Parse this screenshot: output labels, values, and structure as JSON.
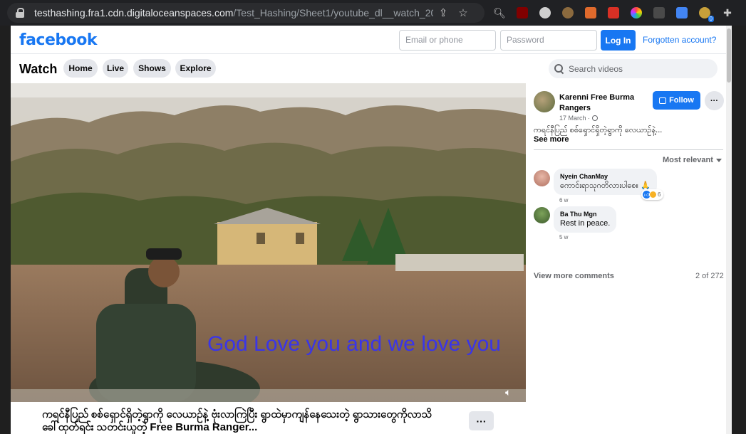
{
  "browser": {
    "url_host": "testhashing.fra1.cdn.digitaloceanspaces.com",
    "url_path": "/Test_Hashing/Sheet1/youtube_dl__watch_20...",
    "extension_badge": "0"
  },
  "header": {
    "logo": "facebook",
    "email_placeholder": "Email or phone",
    "password_placeholder": "Password",
    "login_label": "Log In",
    "forgot_label": "Forgotten account?"
  },
  "watch_nav": {
    "title": "Watch",
    "tabs": [
      {
        "label": "Home"
      },
      {
        "label": "Live"
      },
      {
        "label": "Shows"
      },
      {
        "label": "Explore"
      }
    ],
    "search_placeholder": "Search videos"
  },
  "video": {
    "caption": "God Love you and we love you",
    "post_title": "ကရင်နီပြည် စစ်ရှောင်ရှိတဲ့ရွာကို လေယာဉ်နဲ့ ဗုံးလာကြဲပြီး ရွာထဲမှာကျန်နေသေးတဲ့ ရွာသားတွေကိုလာသိခေါ်ထုတ်ရင်း သတင်းယူတဲ့ Free Burma Ranger..."
  },
  "post": {
    "page_name": "Karenni Free Burma Rangers",
    "date": "17 March ·",
    "follow_label": "Follow",
    "text": "ကရင်နီပြည် စစ်ရှောင်ရှိတဲ့ရွာကို လေယာဉ်နဲ့...",
    "see_more": "See more",
    "sort_label": "Most relevant"
  },
  "comments": [
    {
      "name": "Nyein ChanMay",
      "text": "ကောင်းရာသုဂတိလားပါစေ။ 🙏",
      "time": "6 w",
      "reactions": "6"
    },
    {
      "name": "Ba Thu Mgn",
      "text": "Rest in peace.",
      "time": "5 w"
    }
  ],
  "comments_footer": {
    "view_more": "View more comments",
    "count": "2 of 272"
  },
  "colors": {
    "brand": "#1877f2",
    "caption": "#3a35e8"
  }
}
